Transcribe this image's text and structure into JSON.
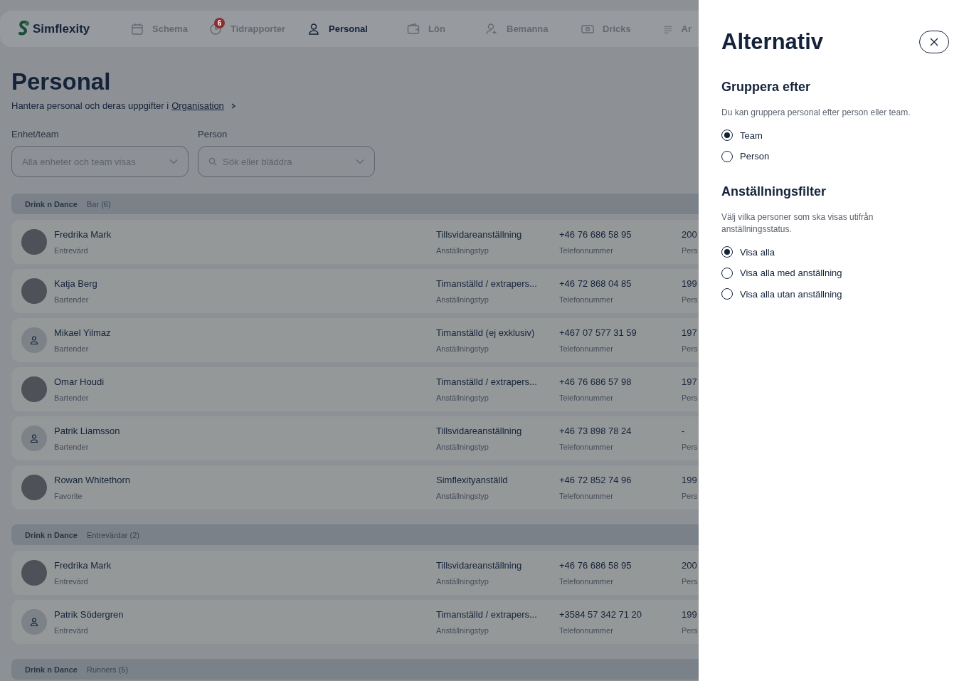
{
  "nav": {
    "logo": "Simflexity",
    "items": [
      {
        "label": "Schema",
        "selected": false
      },
      {
        "label": "Tidrapporter",
        "badge": "6",
        "selected": false
      },
      {
        "label": "Personal",
        "selected": true
      },
      {
        "label": "Lön",
        "selected": false
      },
      {
        "label": "Bemanna",
        "selected": false
      },
      {
        "label": "Dricks",
        "selected": false
      },
      {
        "label": "Ar",
        "selected": false
      }
    ]
  },
  "page": {
    "title": "Personal",
    "subtitle": "Hantera personal och deras uppgifter i ",
    "link": "Organisation"
  },
  "filters": [
    {
      "label": "Enhet/team",
      "placeholder": "Alla enheter och team visas",
      "kind": "select"
    },
    {
      "label": "Person",
      "placeholder": "Sök eller bläddra",
      "kind": "search"
    }
  ],
  "groups": [
    {
      "unit": "Drink n Dance",
      "team": "Bar (6)",
      "rows": [
        {
          "name": "Fredrika Mark",
          "role": "Entrevärd",
          "kind": "photo",
          "type": "Tillsvidareanställning",
          "type_label": "Anställningstyp",
          "phone": "+46 76 686 58 95",
          "phone_label": "Telefonnummer",
          "column_3": "200",
          "column_3_label": "Pers"
        },
        {
          "name": "Katja Berg",
          "role": "Bartender",
          "kind": "photo",
          "type": "Timanställd / extrapers...",
          "type_label": "Anställningstyp",
          "phone": "+46 72 868 04 85",
          "phone_label": "Telefonnummer",
          "column_3": "199",
          "column_3_label": "Pers"
        },
        {
          "name": "Mikael Yilmaz",
          "role": "Bartender",
          "kind": "placeholder",
          "type": "Timanställd (ej exklusiv)",
          "type_label": "Anställningstyp",
          "phone": "+467 07 577 31 59",
          "phone_label": "Telefonnummer",
          "column_3": "197",
          "column_3_label": "Pers"
        },
        {
          "name": "Omar Houdi",
          "role": "Bartender",
          "kind": "photo",
          "type": "Timanställd / extrapers...",
          "type_label": "Anställningstyp",
          "phone": "+46 76 686 57 98",
          "phone_label": "Telefonnummer",
          "column_3": "197",
          "column_3_label": "Pers"
        },
        {
          "name": "Patrik Liamsson",
          "role": "Bartender",
          "kind": "placeholder",
          "type": "Tillsvidareanställning",
          "type_label": "Anställningstyp",
          "phone": "+46 73 898 78 24",
          "phone_label": "Telefonnummer",
          "column_3": "-",
          "column_3_label": "Pers"
        },
        {
          "name": "Rowan Whitethorn",
          "role": "Favorite",
          "kind": "photo",
          "type": "Simflexityanställd",
          "type_label": "Anställningstyp",
          "phone": "+46 72 852 74 96",
          "phone_label": "Telefonnummer",
          "column_3": "199",
          "column_3_label": "Pers"
        }
      ]
    },
    {
      "unit": "Drink n Dance",
      "team": "Entrevärdar (2)",
      "rows": [
        {
          "name": "Fredrika Mark",
          "role": "Entrevärd",
          "kind": "photo",
          "type": "Tillsvidareanställning",
          "type_label": "Anställningstyp",
          "phone": "+46 76 686 58 95",
          "phone_label": "Telefonnummer",
          "column_3": "200",
          "column_3_label": "Pers"
        },
        {
          "name": "Patrik Södergren",
          "role": "Entrevärd",
          "kind": "placeholder",
          "type": "Timanställd / extrapers...",
          "type_label": "Anställningstyp",
          "phone": "+3584 57 342 71 20",
          "phone_label": "Telefonnummer",
          "column_3": "199",
          "column_3_label": "Pers"
        }
      ]
    },
    {
      "unit": "Drink n Dance",
      "team": "Runners (5)"
    }
  ],
  "drawer": {
    "title": "Alternativ",
    "sections": [
      {
        "heading": "Gruppera efter",
        "description": "Du kan gruppera personal efter person eller team.",
        "options": [
          {
            "label": "Team",
            "selected": true
          },
          {
            "label": "Person",
            "selected": false
          }
        ]
      },
      {
        "heading": "Anställningsfilter",
        "description": "Välj vilka personer som ska visas utifrån anställningsstatus.",
        "options": [
          {
            "label": "Visa alla",
            "selected": true
          },
          {
            "label": "Visa alla med anställning",
            "selected": false
          },
          {
            "label": "Visa alla utan anställning",
            "selected": false
          }
        ]
      }
    ]
  }
}
